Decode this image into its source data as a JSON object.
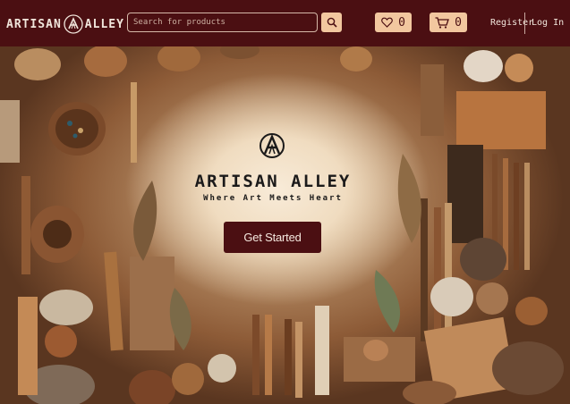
{
  "brand": {
    "left": "ARTISAN",
    "right": "ALLEY",
    "logo_icon": "artisan-alley-logo"
  },
  "search": {
    "placeholder": "Search for products",
    "value": ""
  },
  "header": {
    "wishlist_count": "0",
    "cart_count": "0",
    "register_label": "Register",
    "login_label": "Log In"
  },
  "hero": {
    "title": "ARTISAN ALLEY",
    "tagline": "Where Art Meets Heart",
    "cta_label": "Get Started"
  },
  "colors": {
    "primary": "#4b0f12",
    "accent": "#f2c79f",
    "text_light": "#f1e6dc"
  }
}
